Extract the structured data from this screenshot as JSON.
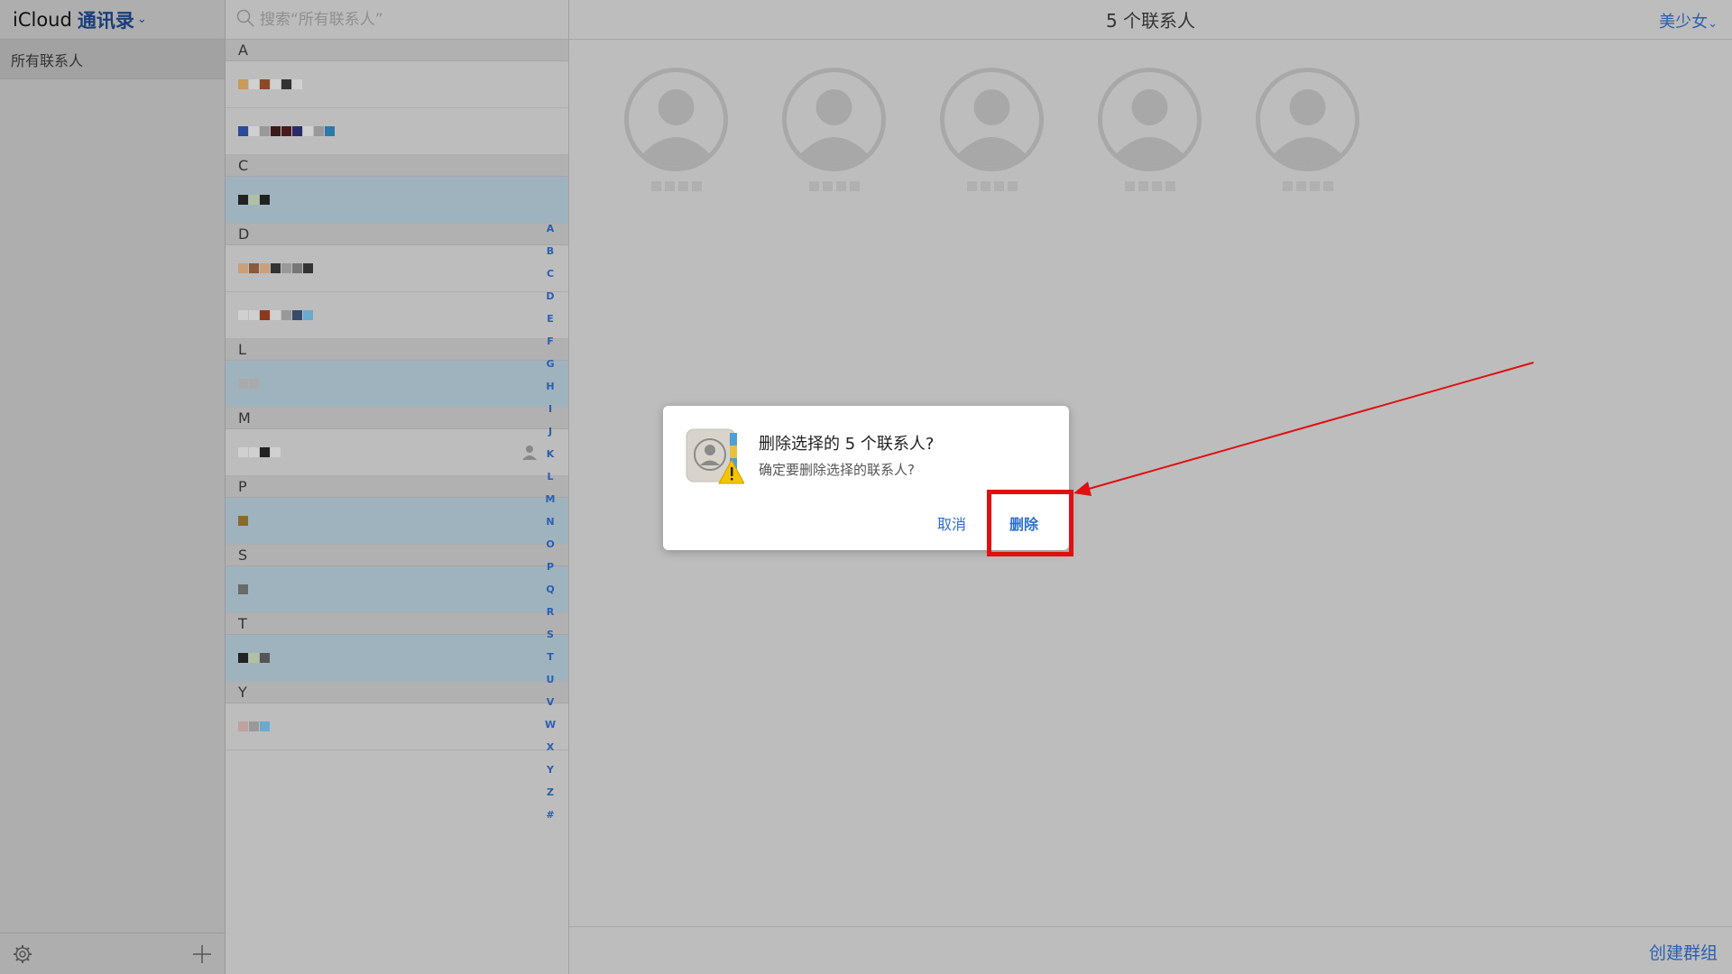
{
  "sidebar": {
    "brand": "iCloud",
    "app_name": "通讯录",
    "groups": [
      {
        "label": "所有联系人"
      }
    ]
  },
  "search": {
    "placeholder": "搜索“所有联系人”"
  },
  "list": {
    "sections": [
      {
        "letter": "A",
        "rows": [
          {
            "selected": false,
            "blocks": [
              "#c99a5a",
              "#d0d0d0",
              "#8a4a28",
              "#d0d0d0",
              "#333333",
              "#d0d0d0"
            ]
          },
          {
            "selected": false,
            "blocks": [
              "#2a4a9a",
              "#d0d0d0",
              "#999999",
              "#3a1a1a",
              "#4a1a1a",
              "#2a2a6a",
              "#d0d0d0",
              "#999999",
              "#2a7aaa"
            ]
          }
        ]
      },
      {
        "letter": "C",
        "rows": [
          {
            "selected": true,
            "blocks": [
              "#222222",
              "#b0c0a0",
              "#222222"
            ]
          }
        ]
      },
      {
        "letter": "D",
        "rows": [
          {
            "selected": false,
            "blocks": [
              "#c9a07a",
              "#8a5a3a",
              "#c9a07a",
              "#333333",
              "#999999",
              "#777777",
              "#333333"
            ]
          },
          {
            "selected": false,
            "blocks": [
              "#d0d0d0",
              "#d0d0d0",
              "#8a3a1a",
              "#d0d0d0",
              "#999999",
              "#3a4a6a",
              "#6aaacf"
            ]
          }
        ]
      },
      {
        "letter": "L",
        "rows": [
          {
            "selected": true,
            "blocks": [
              "#aaaaaa",
              "#aaaaaa"
            ]
          }
        ]
      },
      {
        "letter": "M",
        "rows": [
          {
            "selected": false,
            "blocks": [
              "#d0d0d0",
              "#d0d0d0",
              "#222222",
              "#d0d0d0"
            ],
            "placeholder_icon": true
          }
        ]
      },
      {
        "letter": "P",
        "rows": [
          {
            "selected": true,
            "blocks": [
              "#8a6a2a"
            ]
          }
        ]
      },
      {
        "letter": "S",
        "rows": [
          {
            "selected": true,
            "blocks": [
              "#6a6a6a"
            ]
          }
        ]
      },
      {
        "letter": "T",
        "rows": [
          {
            "selected": true,
            "blocks": [
              "#222222",
              "#b0c0a0",
              "#555555"
            ]
          }
        ]
      },
      {
        "letter": "Y",
        "rows": [
          {
            "selected": false,
            "blocks": [
              "#c0a0a0",
              "#999999",
              "#6aaacf"
            ]
          }
        ]
      }
    ],
    "index_letters": [
      "A",
      "B",
      "C",
      "D",
      "E",
      "F",
      "G",
      "H",
      "I",
      "J",
      "K",
      "L",
      "M",
      "N",
      "O",
      "P",
      "Q",
      "R",
      "S",
      "T",
      "U",
      "V",
      "W",
      "X",
      "Y",
      "Z",
      "#"
    ]
  },
  "detail": {
    "header_title": "5 个联系人",
    "user_name": "美少女",
    "avatar_count": 5,
    "create_group_label": "创建群组"
  },
  "dialog": {
    "title": "删除选择的 5 个联系人?",
    "message": "确定要删除选择的联系人?",
    "cancel_label": "取消",
    "delete_label": "删除"
  },
  "annotation": {
    "highlight_color": "#e01010",
    "arrow_color": "#e01010"
  },
  "colors": {
    "accent": "#2a6fd0",
    "selected_row": "#9fb3bf"
  }
}
